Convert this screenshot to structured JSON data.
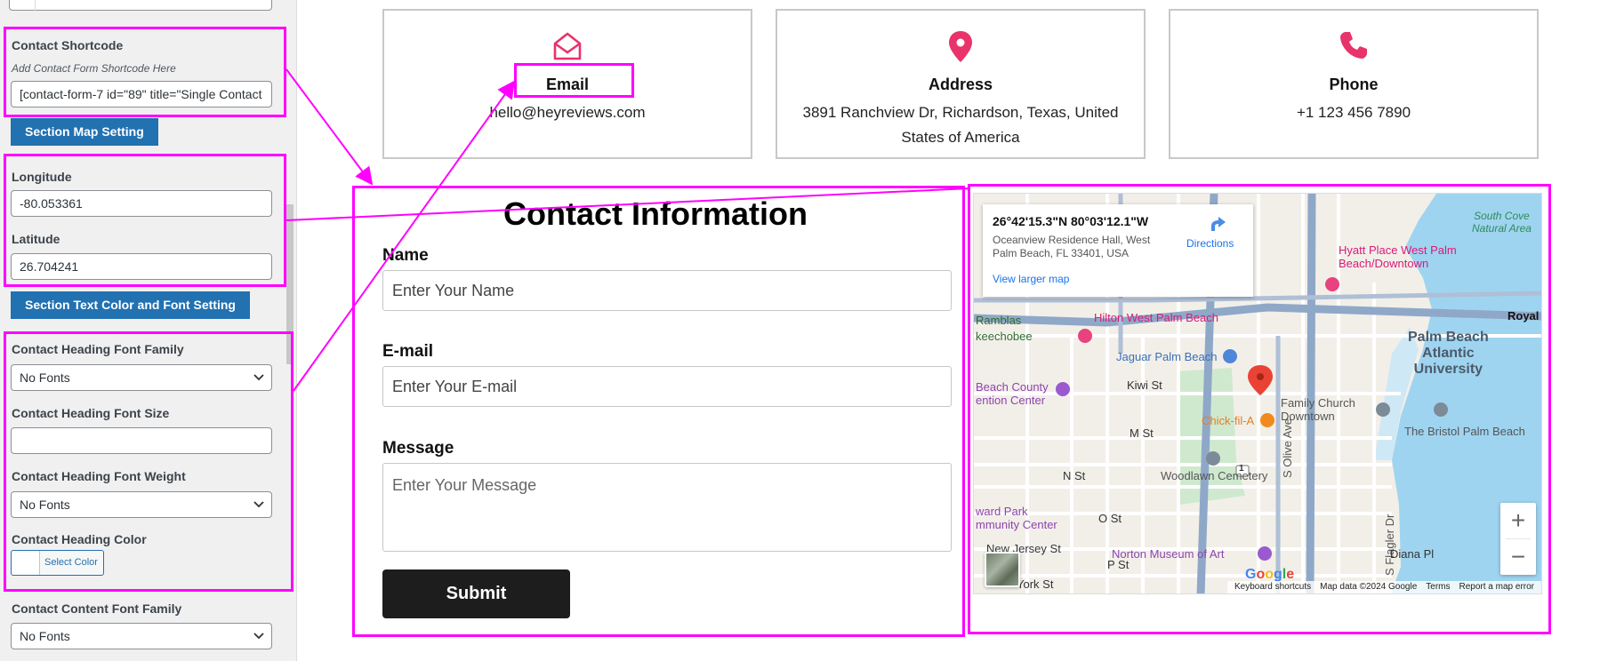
{
  "settings_panel": {
    "contact_shortcode": {
      "label": "Contact Shortcode",
      "help": "Add Contact Form Shortcode Here",
      "value": "[contact-form-7 id=\"89\" title=\"Single Contact"
    },
    "section_map_button": "Section Map Setting",
    "longitude": {
      "label": "Longitude",
      "value": "-80.053361"
    },
    "latitude": {
      "label": "Latitude",
      "value": "26.704241"
    },
    "section_text_button": "Section Text Color and Font Setting",
    "heading_font_family": {
      "label": "Contact Heading Font Family",
      "value": "No Fonts"
    },
    "heading_font_size": {
      "label": "Contact Heading Font Size",
      "value": ""
    },
    "heading_font_weight": {
      "label": "Contact Heading Font Weight",
      "value": "No Fonts"
    },
    "heading_color": {
      "label": "Contact Heading Color",
      "button": "Select Color"
    },
    "content_font_family": {
      "label": "Contact Content Font Family",
      "value": "No Fonts"
    }
  },
  "cards": [
    {
      "icon": "envelope-open-icon",
      "title": "Email",
      "text": "hello@heyreviews.com"
    },
    {
      "icon": "map-pin-icon",
      "title": "Address",
      "text": "3891 Ranchview Dr, Richardson, Texas, United States of America"
    },
    {
      "icon": "phone-icon",
      "title": "Phone",
      "text": "+1 123 456 7890"
    }
  ],
  "form": {
    "title": "Contact Information",
    "name_label": "Name",
    "name_placeholder": "Enter Your Name",
    "email_label": "E-mail",
    "email_placeholder": "Enter Your E-mail",
    "message_label": "Message",
    "message_placeholder": "Enter Your Message",
    "submit": "Submit"
  },
  "map": {
    "coords": "26°42'15.3\"N 80°03'12.1\"W",
    "address": "Oceanview Residence Hall, West Palm Beach, FL 33401, USA",
    "directions": "Directions",
    "view_larger": "View larger map",
    "labels": {
      "south_cove": "South Cove\nNatural Area",
      "hyatt": "Hyatt Place West Palm\nBeach/Downtown",
      "ramblas": "Ramblas",
      "keechobee": "keechobee",
      "hilton": "Hilton West Palm Beach",
      "royal": "Royal P",
      "palm_beach_atlantic": "Palm Beach\nAtlantic\nUniversity",
      "jaguar": "Jaguar Palm Beach",
      "beach_county": "Beach County\nention Center",
      "kiwi": "Kiwi St",
      "family_church": "Family Church\nDowntown",
      "chick": "Chick-fil-A",
      "m_st": "M St",
      "bristol": "The Bristol Palm Beach",
      "n_st": "N St",
      "woodlawn": "Woodlawn Cemetery",
      "olive": "S Olive Ave",
      "ward_park": "ward Park\nmmunity Center",
      "o_st": "O St",
      "new_jersey": "New Jersey St",
      "norton": "Norton Museum of Art",
      "flagler": "S Flagler Dr",
      "diana": "Diana Pl",
      "p_st": "P St",
      "york": "York St",
      "route": "1"
    },
    "google": "Google",
    "attribution": [
      "Keyboard shortcuts",
      "Map data ©2024 Google",
      "Terms",
      "Report a map error"
    ],
    "zoom_in": "+",
    "zoom_out": "−"
  }
}
